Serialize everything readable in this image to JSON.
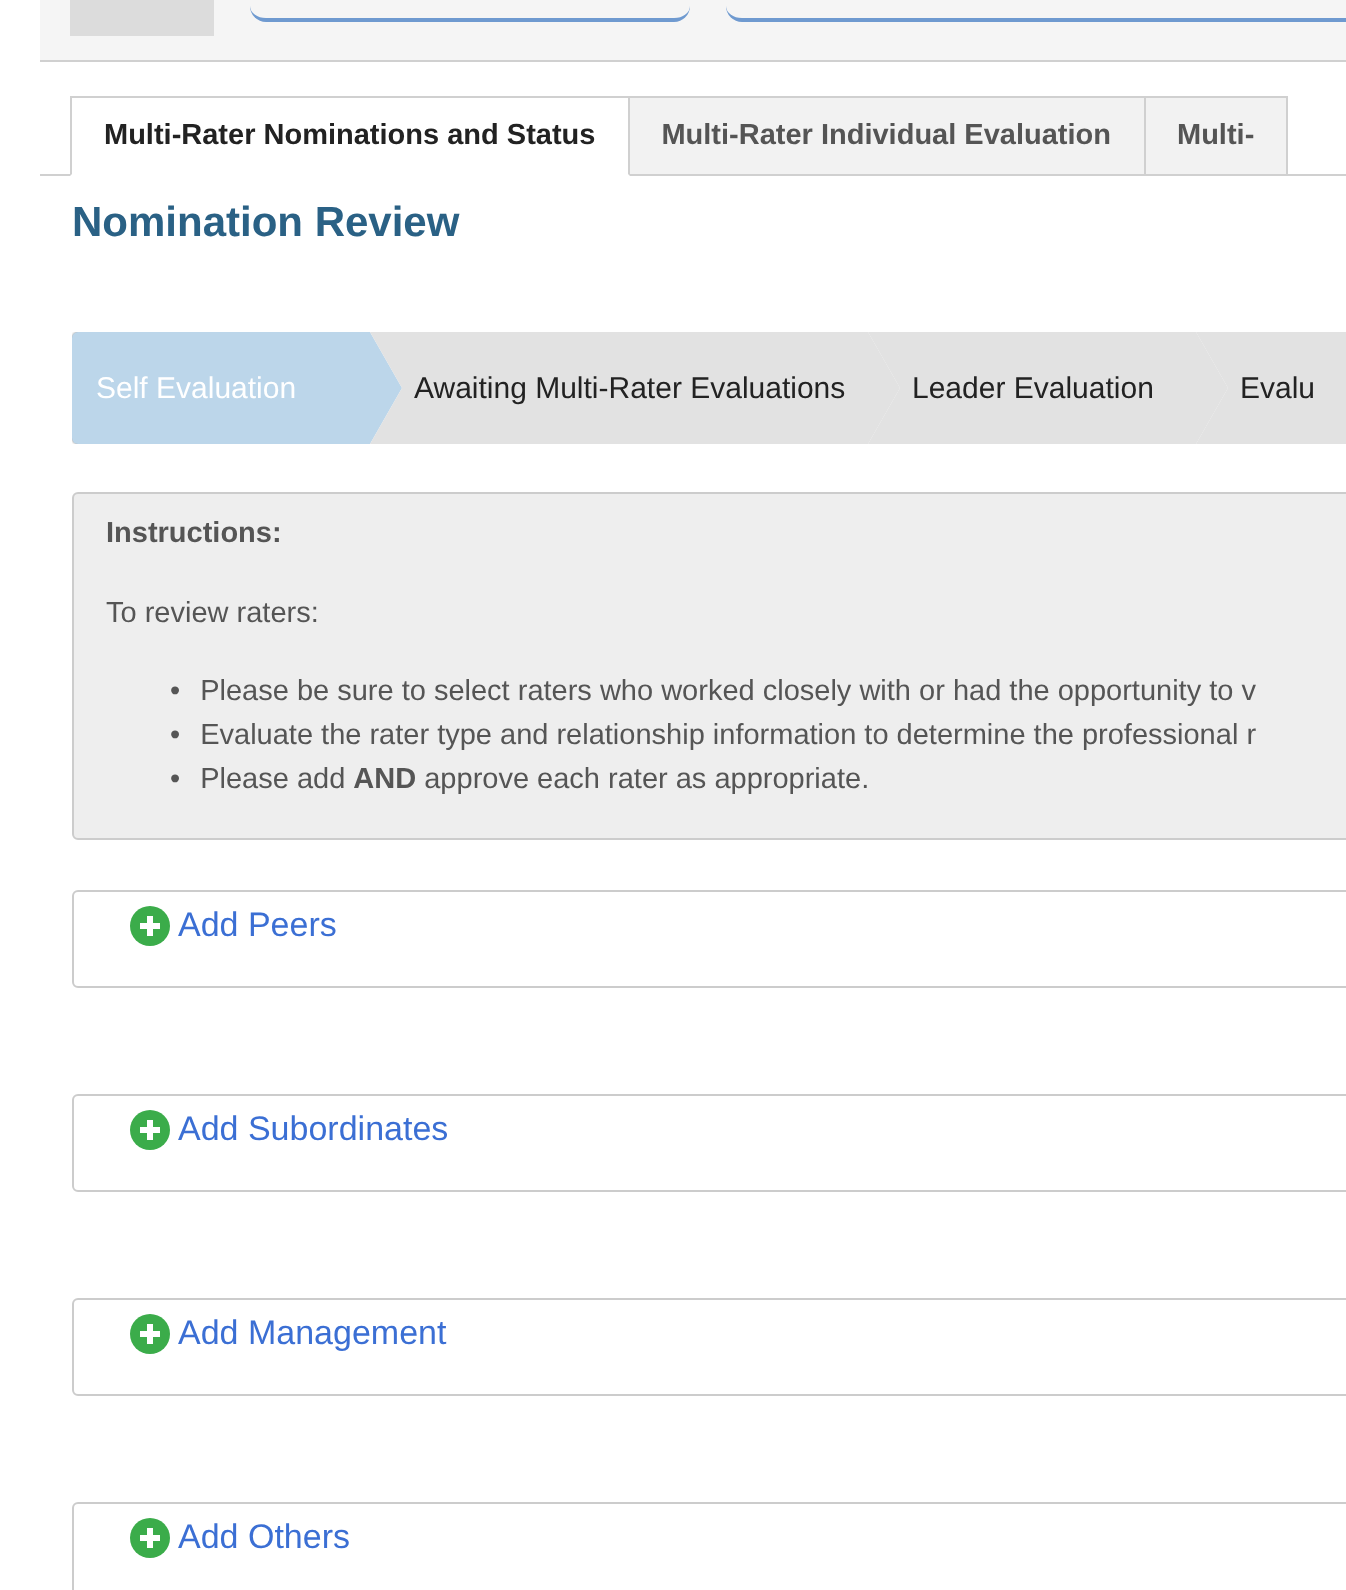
{
  "tabs": [
    {
      "label": "Multi-Rater Nominations and Status",
      "selected": true
    },
    {
      "label": "Multi-Rater Individual Evaluation",
      "selected": false
    },
    {
      "label": "Multi-",
      "selected": false
    }
  ],
  "title": "Nomination Review",
  "steps": [
    {
      "label": "Self Evaluation",
      "selected": true
    },
    {
      "label": "Awaiting Multi-Rater Evaluations",
      "selected": false
    },
    {
      "label": "Leader Evaluation",
      "selected": false
    },
    {
      "label": "Evalu",
      "selected": false
    }
  ],
  "instructions": {
    "heading": "Instructions:",
    "intro": "To review raters:",
    "bullets": [
      {
        "marker": "•",
        "text": "Please be sure to select raters who worked closely with or had the opportunity to v"
      },
      {
        "marker": "•",
        "text": "Evaluate the rater type and relationship information to determine the professional r"
      },
      {
        "marker": "•",
        "text": "Please add **AND** approve each rater as appropriate."
      }
    ]
  },
  "sections": [
    {
      "label": "Add Peers"
    },
    {
      "label": "Add Subordinates"
    },
    {
      "label": "Add Management"
    },
    {
      "label": "Add Others"
    }
  ]
}
